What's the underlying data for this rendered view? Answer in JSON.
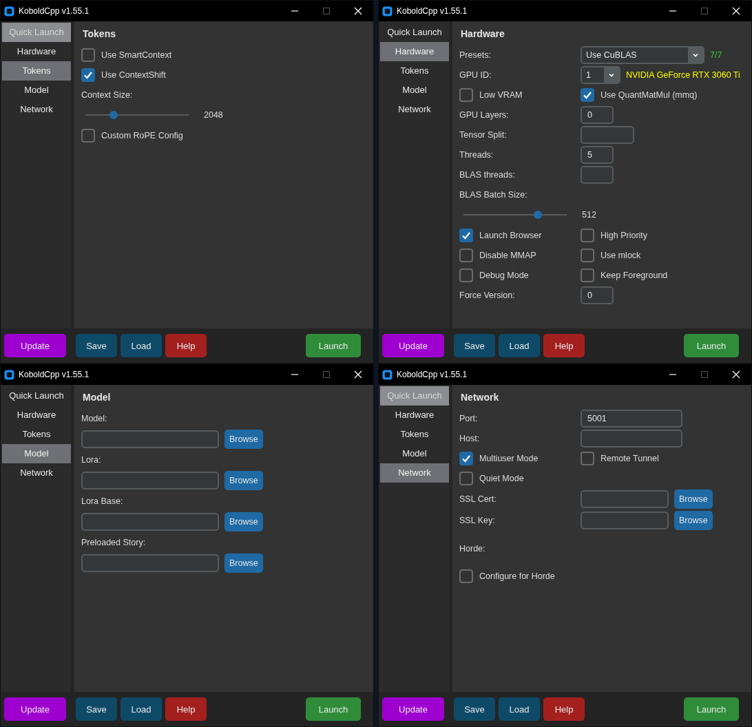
{
  "windows": [
    {
      "title": "KoboldCpp v1.55.1",
      "sidebar": {
        "items": [
          {
            "label": "Quick Launch",
            "selected": false,
            "highlighted": true
          },
          {
            "label": "Hardware",
            "selected": false,
            "highlighted": false
          },
          {
            "label": "Tokens",
            "selected": true,
            "highlighted": false
          },
          {
            "label": "Model",
            "selected": false,
            "highlighted": false
          },
          {
            "label": "Network",
            "selected": false,
            "highlighted": false
          }
        ]
      },
      "panel": {
        "title": "Tokens",
        "rows": [
          {
            "kind": "checkbox",
            "label": "Use SmartContext",
            "checked": false
          },
          {
            "kind": "checkbox",
            "label": "Use ContextShift",
            "checked": true
          },
          {
            "kind": "label",
            "text": "Context Size:"
          },
          {
            "kind": "slider",
            "level": 0.27,
            "reading": "2048"
          },
          {
            "kind": "checkbox",
            "label": "Custom RoPE Config",
            "checked": false
          }
        ]
      },
      "buttons": [
        {
          "label": "Update",
          "color": "#9e00d0"
        },
        {
          "label": "Save",
          "color": "#0e4a68"
        },
        {
          "label": "Load",
          "color": "#0e4a68"
        },
        {
          "label": "Help",
          "color": "#a3201f"
        },
        {
          "label": "Launch",
          "color": "#2f8d3a"
        }
      ]
    },
    {
      "title": "KoboldCpp v1.55.1",
      "sidebar": {
        "items": [
          {
            "label": "Quick Launch",
            "selected": false,
            "highlighted": false
          },
          {
            "label": "Hardware",
            "selected": true,
            "highlighted": false
          },
          {
            "label": "Tokens",
            "selected": false,
            "highlighted": false
          },
          {
            "label": "Model",
            "selected": false,
            "highlighted": false
          },
          {
            "label": "Network",
            "selected": false,
            "highlighted": false
          }
        ]
      },
      "panel": {
        "title": "Hardware",
        "rows": [
          {
            "kind": "dropdown",
            "label": "Presets:",
            "value": "Use CuBLAS",
            "note": "7/7",
            "color": "#33cc33"
          },
          {
            "kind": "small_dropdown",
            "label": "GPU ID:",
            "value": "1",
            "note": "NVIDIA GeForce RTX 3060 Ti",
            "color": "#ffff00"
          },
          {
            "kind": "check_pair",
            "items": [
              {
                "label": "Low VRAM",
                "checked": false
              },
              {
                "label": "Use QuantMatMul (mmq)",
                "checked": true
              }
            ]
          },
          {
            "kind": "field",
            "label": "GPU Layers:",
            "value": "0"
          },
          {
            "kind": "medium_field",
            "label": "Tensor Split:"
          },
          {
            "kind": "field",
            "label": "Threads:",
            "value": "5"
          },
          {
            "kind": "field",
            "label": "BLAS threads:"
          },
          {
            "kind": "label",
            "text": "BLAS Batch Size:"
          },
          {
            "kind": "slider",
            "level": 0.72,
            "reading": "512"
          },
          {
            "kind": "check_pair",
            "items": [
              {
                "label": "Launch Browser",
                "checked": true
              },
              {
                "label": "High Priority",
                "checked": false
              }
            ]
          },
          {
            "kind": "check_pair",
            "items": [
              {
                "label": "Disable MMAP",
                "checked": false
              },
              {
                "label": "Use mlock",
                "checked": false
              }
            ]
          },
          {
            "kind": "check_pair",
            "items": [
              {
                "label": "Debug Mode",
                "checked": false
              },
              {
                "label": "Keep Foreground",
                "checked": false
              }
            ]
          },
          {
            "kind": "field",
            "label": "Force Version:",
            "value": "0"
          }
        ]
      },
      "buttons": [
        {
          "label": "Update",
          "color": "#9e00d0"
        },
        {
          "label": "Save",
          "color": "#0e4a68"
        },
        {
          "label": "Load",
          "color": "#0e4a68"
        },
        {
          "label": "Help",
          "color": "#a3201f"
        },
        {
          "label": "Launch",
          "color": "#2f8d3a"
        }
      ]
    },
    {
      "title": "KoboldCpp v1.55.1",
      "sidebar": {
        "items": [
          {
            "label": "Quick Launch",
            "selected": false,
            "highlighted": false
          },
          {
            "label": "Hardware",
            "selected": false,
            "highlighted": false
          },
          {
            "label": "Tokens",
            "selected": false,
            "highlighted": false
          },
          {
            "label": "Model",
            "selected": true,
            "highlighted": false
          },
          {
            "label": "Network",
            "selected": false,
            "highlighted": false
          }
        ]
      },
      "panel": {
        "title": "Model",
        "rows": [
          {
            "kind": "label",
            "text": "Model:"
          },
          {
            "kind": "file",
            "button": "Browse"
          },
          {
            "kind": "label",
            "text": "Lora:"
          },
          {
            "kind": "file",
            "button": "Browse"
          },
          {
            "kind": "label",
            "text": "Lora Base:"
          },
          {
            "kind": "file",
            "button": "Browse"
          },
          {
            "kind": "label",
            "text": "Preloaded Story:"
          },
          {
            "kind": "file",
            "button": "Browse"
          }
        ]
      },
      "buttons": [
        {
          "label": "Update",
          "color": "#9e00d0"
        },
        {
          "label": "Save",
          "color": "#0e4a68"
        },
        {
          "label": "Load",
          "color": "#0e4a68"
        },
        {
          "label": "Help",
          "color": "#a3201f"
        },
        {
          "label": "Launch",
          "color": "#2f8d3a"
        }
      ]
    },
    {
      "title": "KoboldCpp v1.55.1",
      "sidebar": {
        "items": [
          {
            "label": "Quick Launch",
            "selected": false,
            "highlighted": true
          },
          {
            "label": "Hardware",
            "selected": false,
            "highlighted": false
          },
          {
            "label": "Tokens",
            "selected": false,
            "highlighted": false
          },
          {
            "label": "Model",
            "selected": false,
            "highlighted": false
          },
          {
            "label": "Network",
            "selected": true,
            "highlighted": false
          }
        ]
      },
      "panel": {
        "title": "Network",
        "rows": [
          {
            "kind": "wide_field",
            "label": "Port:",
            "value": "5001"
          },
          {
            "kind": "wide_field",
            "label": "Host:"
          },
          {
            "kind": "check_pair",
            "items": [
              {
                "label": "Multiuser Mode",
                "checked": true
              },
              {
                "label": "Remote Tunnel",
                "checked": false
              }
            ]
          },
          {
            "kind": "checkbox",
            "label": "Quiet Mode",
            "checked": false
          },
          {
            "kind": "labeled_file",
            "label": "SSL Cert:",
            "button": "Browse"
          },
          {
            "kind": "labeled_file",
            "label": "SSL Key:",
            "button": "Browse"
          },
          {
            "kind": "section_label",
            "text": "Horde:"
          },
          {
            "kind": "section_checkbox",
            "label": "Configure for Horde",
            "checked": false
          }
        ]
      },
      "buttons": [
        {
          "label": "Update",
          "color": "#9e00d0"
        },
        {
          "label": "Save",
          "color": "#0e4a68"
        },
        {
          "label": "Load",
          "color": "#0e4a68"
        },
        {
          "label": "Help",
          "color": "#a3201f"
        },
        {
          "label": "Launch",
          "color": "#2f8d3a"
        }
      ]
    }
  ]
}
